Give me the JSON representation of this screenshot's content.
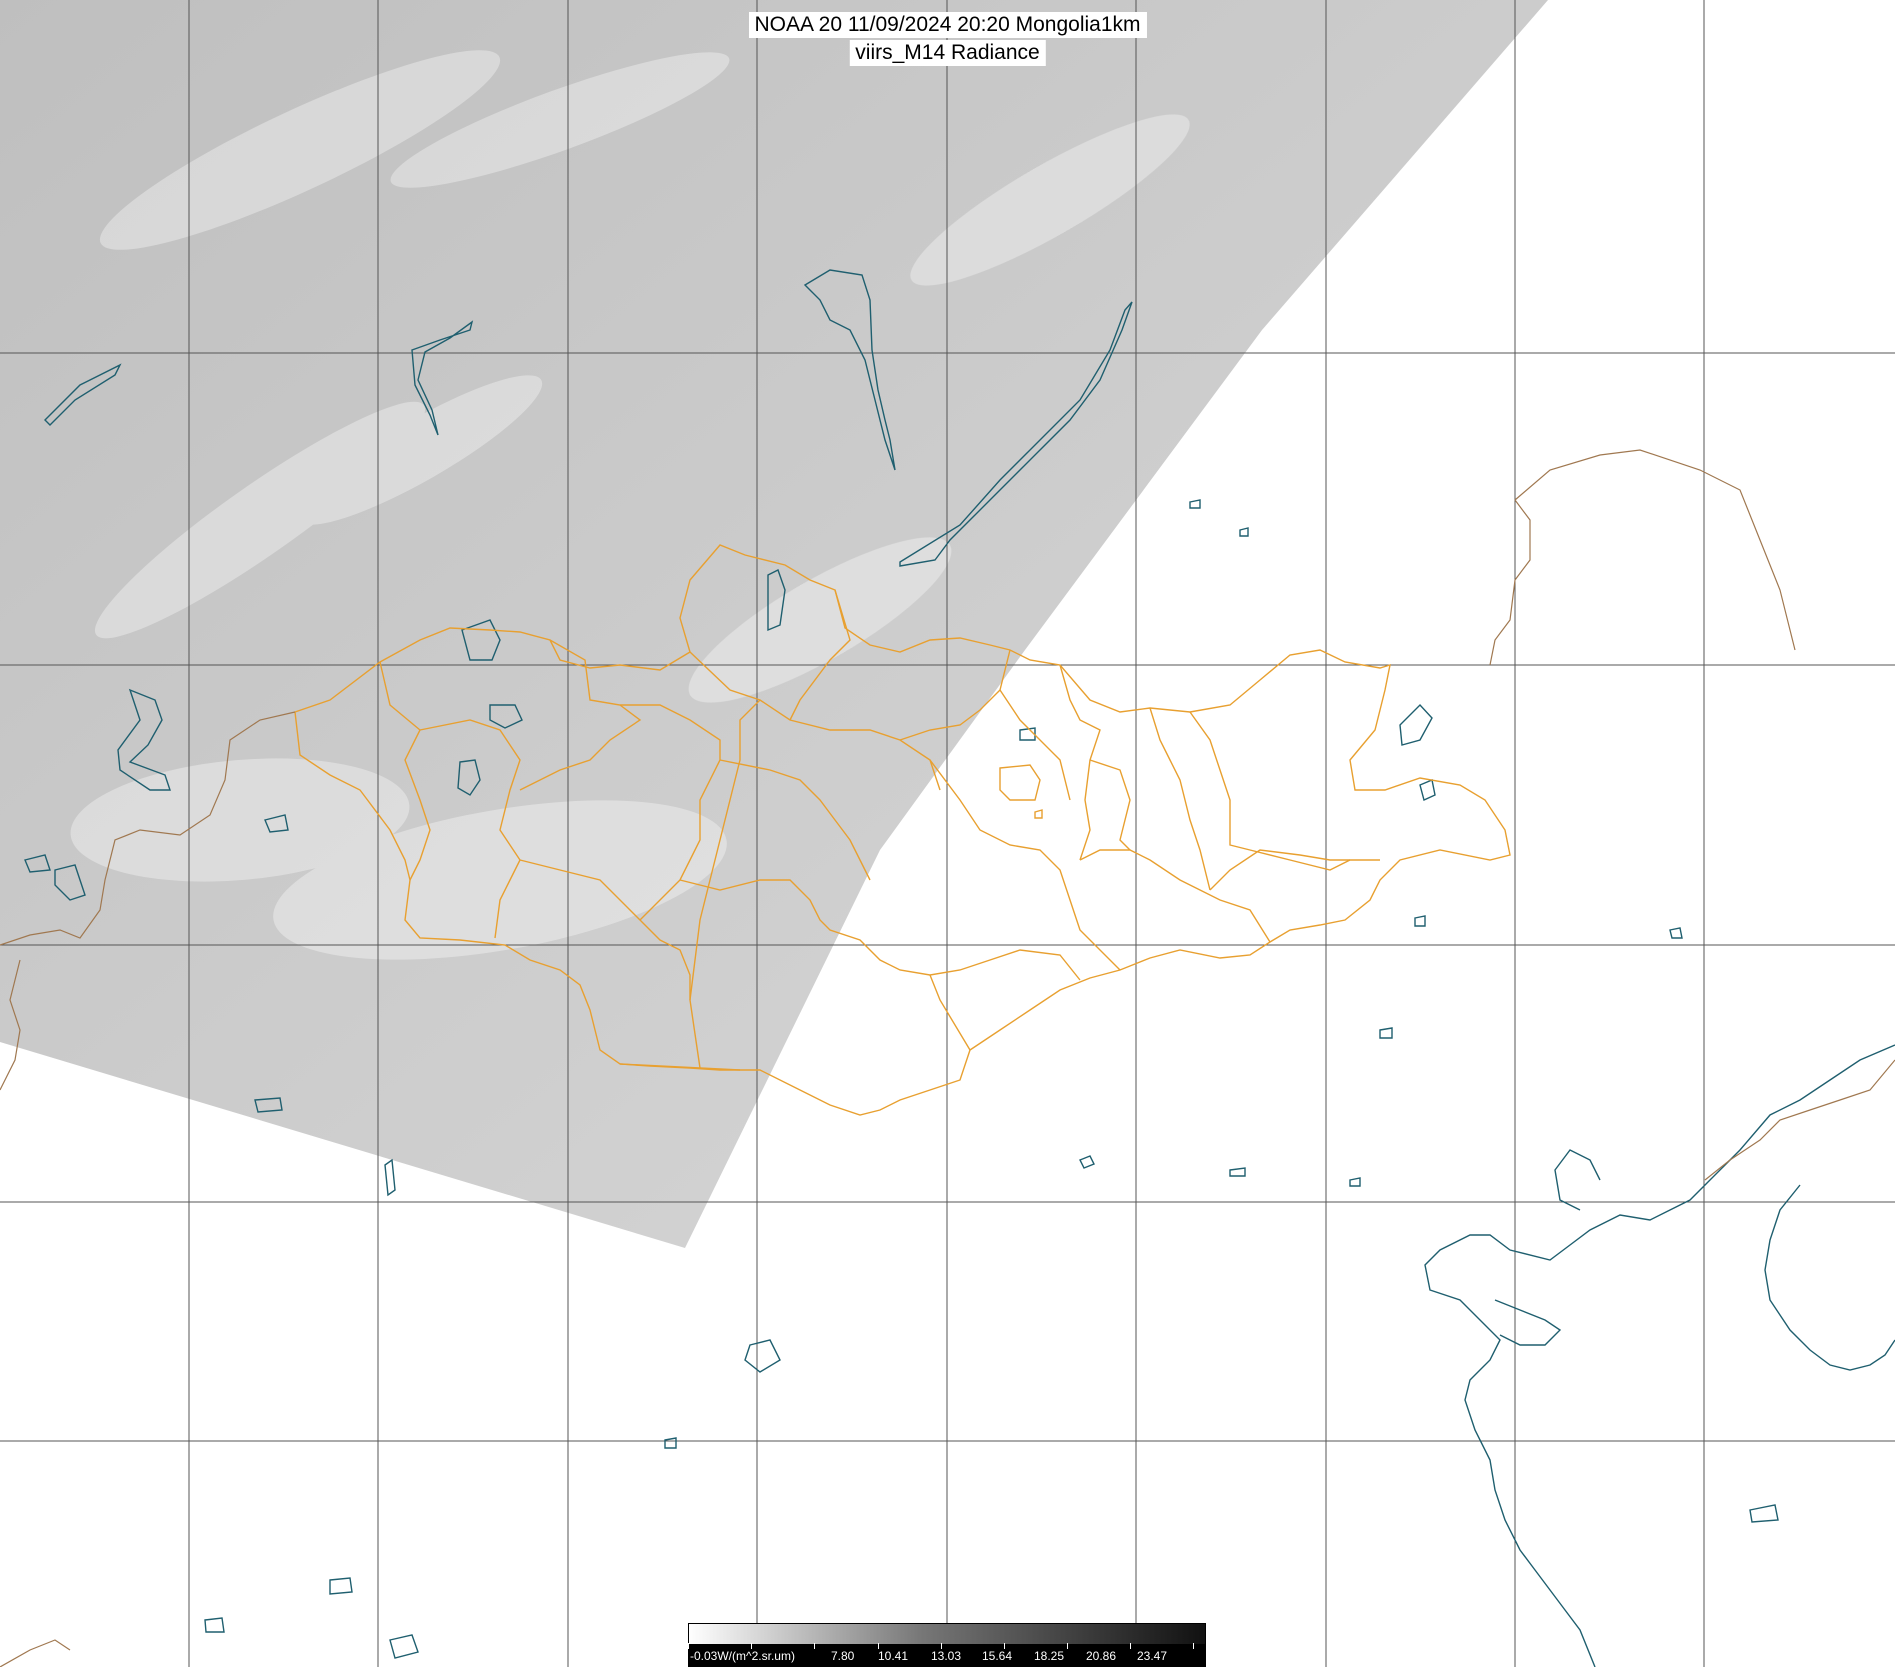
{
  "title": {
    "line1": "NOAA 20 11/09/2024 20:20 Mongolia1km",
    "line2": "viirs_M14 Radiance"
  },
  "colorbar": {
    "unit_label": "-0.03W/(m^2.sr.um)",
    "tick_values": [
      "7.80",
      "10.41",
      "13.03",
      "15.64",
      "18.25",
      "20.86",
      "23.47"
    ],
    "gradient_colors": [
      "#ffffff",
      "#777777",
      "#111111"
    ]
  },
  "colors": {
    "swath": "#c9c9c9",
    "grid": "#555555",
    "water_outline": "#1f5f6f",
    "mongolia_border": "#e8a030",
    "country_border": "#a07850",
    "background": "#ffffff"
  },
  "layers": [
    "satellite-swath",
    "lat-lon-grid",
    "lakes-coastlines",
    "mongolia-aimag-borders",
    "country-borders"
  ]
}
